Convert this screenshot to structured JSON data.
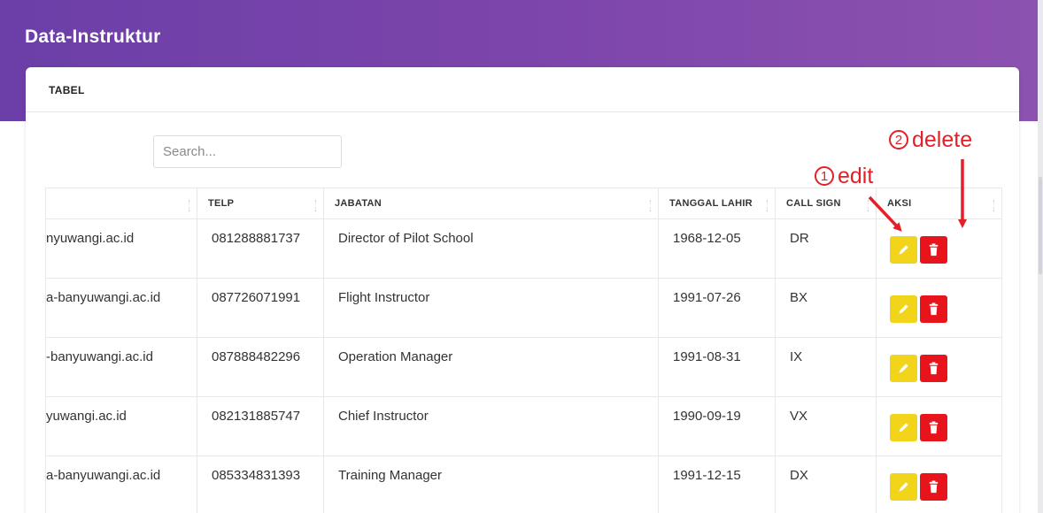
{
  "page": {
    "title": "Data-Instruktur"
  },
  "card": {
    "header": "TABEL"
  },
  "search": {
    "placeholder": "Search..."
  },
  "table": {
    "columns": [
      "",
      "TELP",
      "JABATAN",
      "TANGGAL LAHIR",
      "CALL SIGN",
      "AKSI"
    ],
    "rows": [
      {
        "email": "nyuwangi.ac.id",
        "telp": "081288881737",
        "jabatan": "Director of Pilot School",
        "tanggal_lahir": "1968-12-05",
        "call_sign": "DR"
      },
      {
        "email": "a-banyuwangi.ac.id",
        "telp": "087726071991",
        "jabatan": "Flight Instructor",
        "tanggal_lahir": "1991-07-26",
        "call_sign": "BX"
      },
      {
        "email": "-banyuwangi.ac.id",
        "telp": "087888482296",
        "jabatan": "Operation Manager",
        "tanggal_lahir": "1991-08-31",
        "call_sign": "IX"
      },
      {
        "email": "yuwangi.ac.id",
        "telp": "082131885747",
        "jabatan": "Chief Instructor",
        "tanggal_lahir": "1990-09-19",
        "call_sign": "VX"
      },
      {
        "email": "a-banyuwangi.ac.id",
        "telp": "085334831393",
        "jabatan": "Training Manager",
        "tanggal_lahir": "1991-12-15",
        "call_sign": "DX"
      }
    ]
  },
  "annotations": {
    "edit": {
      "number": "1",
      "label": "edit"
    },
    "delete": {
      "number": "2",
      "label": "delete"
    }
  },
  "icons": {
    "edit": "pencil-icon",
    "delete": "trash-icon",
    "sort": "sort-arrows-icon"
  },
  "colors": {
    "header_start": "#6b3fa8",
    "header_end": "#8d52b0",
    "edit_button": "#f2d51b",
    "delete_button": "#e8141c",
    "annotation": "#e32028"
  }
}
